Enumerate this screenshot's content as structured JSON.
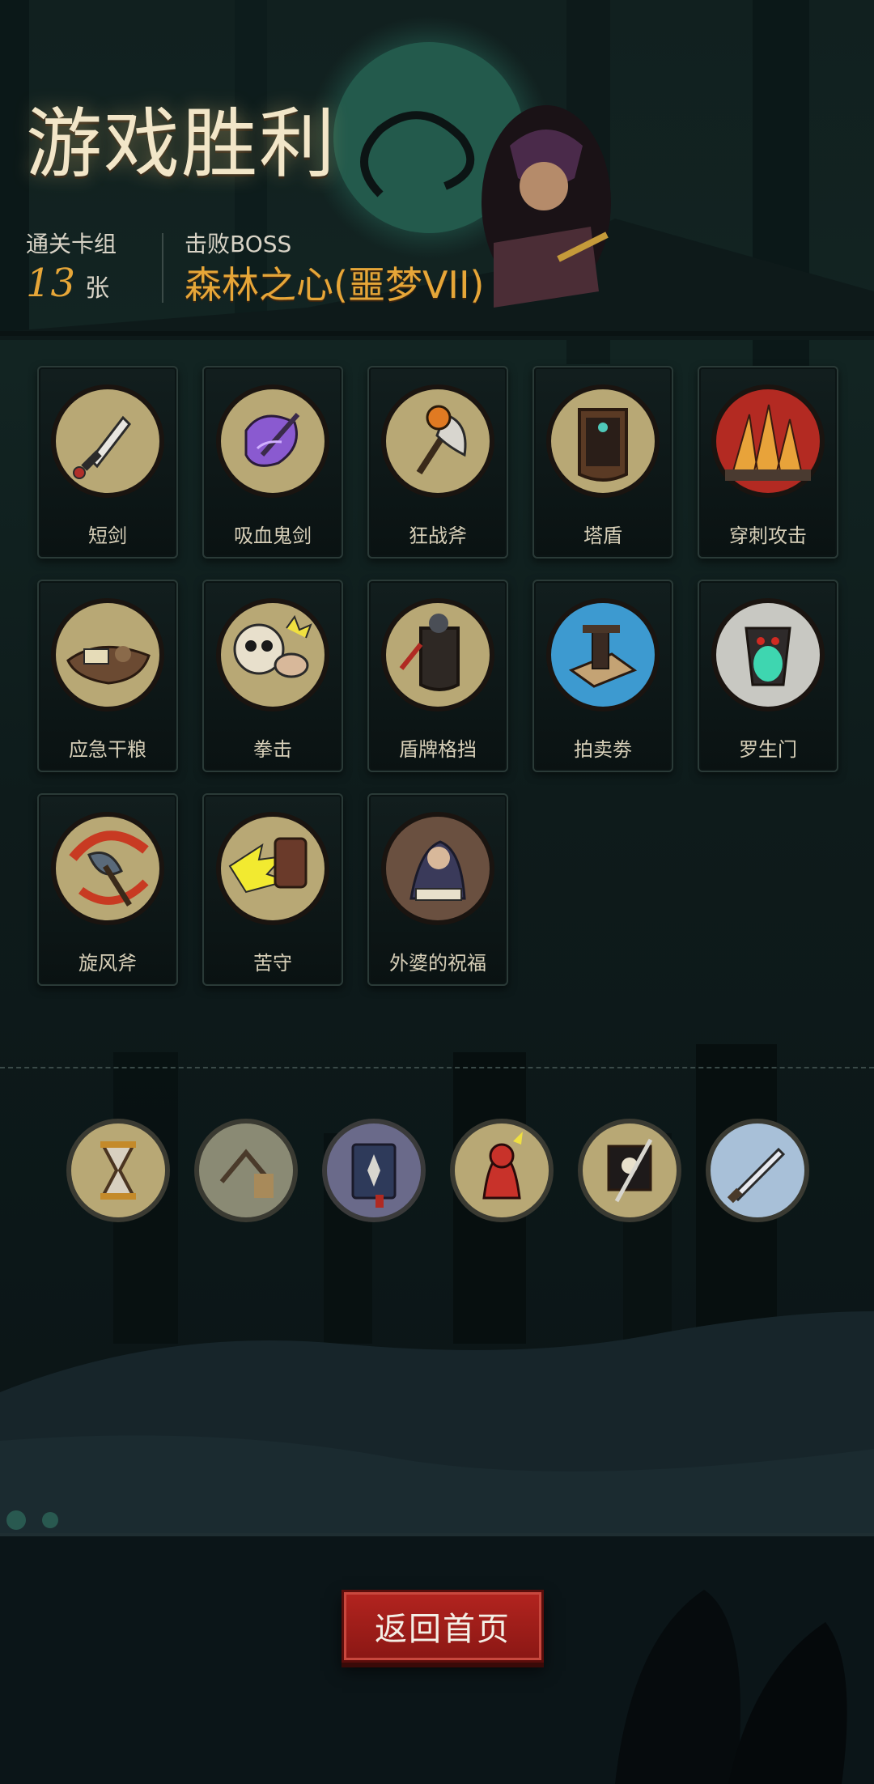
{
  "header": {
    "title": "游戏胜利",
    "deck_label": "通关卡组",
    "deck_count": "13",
    "deck_unit": "张",
    "boss_label": "击败BOSS",
    "boss_name": "森林之心(噩梦VII)"
  },
  "cards": [
    {
      "name": "短剑",
      "icon": "dagger-icon"
    },
    {
      "name": "吸血鬼剑",
      "icon": "vampire-sword-icon"
    },
    {
      "name": "狂战斧",
      "icon": "berserker-axe-icon"
    },
    {
      "name": "塔盾",
      "icon": "tower-shield-icon"
    },
    {
      "name": "穿刺攻击",
      "icon": "spike-attack-icon"
    },
    {
      "name": "应急干粮",
      "icon": "ration-icon"
    },
    {
      "name": "拳击",
      "icon": "punch-icon"
    },
    {
      "name": "盾牌格挡",
      "icon": "shield-block-icon"
    },
    {
      "name": "拍卖劵",
      "icon": "auction-ticket-icon"
    },
    {
      "name": "罗生门",
      "icon": "demon-gate-icon"
    },
    {
      "name": "旋风斧",
      "icon": "whirlwind-axe-icon"
    },
    {
      "name": "苦守",
      "icon": "endure-icon"
    },
    {
      "name": "外婆的祝福",
      "icon": "grandma-blessing-icon"
    }
  ],
  "relics": [
    {
      "icon": "hourglass-icon"
    },
    {
      "icon": "trap-icon"
    },
    {
      "icon": "spellbook-icon"
    },
    {
      "icon": "imp-icon"
    },
    {
      "icon": "pirate-flag-icon"
    },
    {
      "icon": "blade-icon"
    }
  ],
  "footer": {
    "return_label": "返回首页"
  },
  "colors": {
    "accent_gold": "#e6a638",
    "button_red": "#b3241f",
    "card_bg": "#0e1818",
    "medallion_bg": "#b8a875"
  }
}
